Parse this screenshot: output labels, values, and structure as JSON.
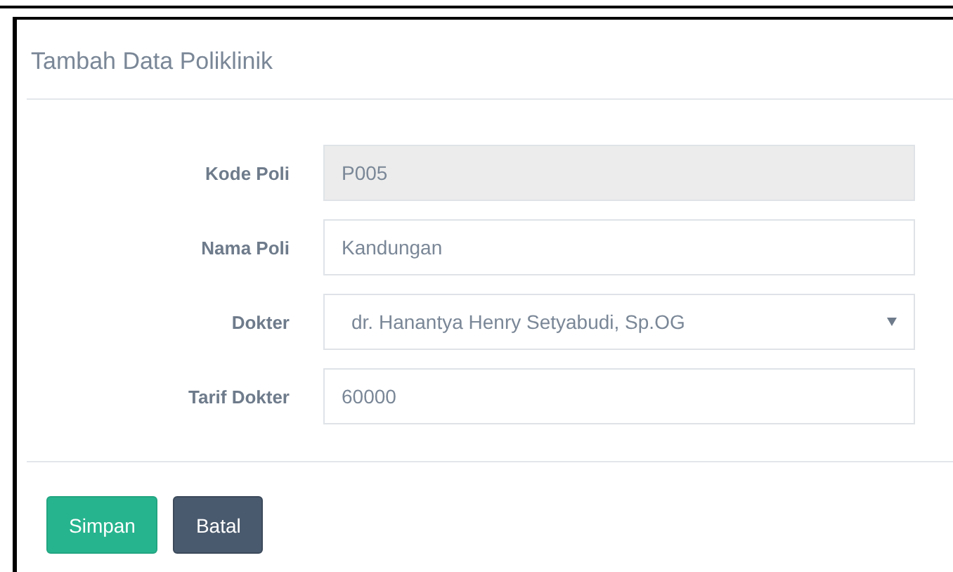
{
  "panel": {
    "title": "Tambah Data Poliklinik"
  },
  "fields": [
    {
      "label": "Kode Poli",
      "kind": "input",
      "value": "P005",
      "disabled": true
    },
    {
      "label": "Nama Poli",
      "kind": "input",
      "value": "Kandungan",
      "disabled": false
    },
    {
      "label": "Dokter",
      "kind": "select",
      "value": "dr. Hanantya Henry Setyabudi, Sp.OG",
      "disabled": false
    },
    {
      "label": "Tarif Dokter",
      "kind": "input",
      "value": "60000",
      "disabled": false
    }
  ],
  "buttons": [
    {
      "label": "Simpan",
      "kind": "primary"
    },
    {
      "label": "Batal",
      "kind": "secondary"
    }
  ]
}
